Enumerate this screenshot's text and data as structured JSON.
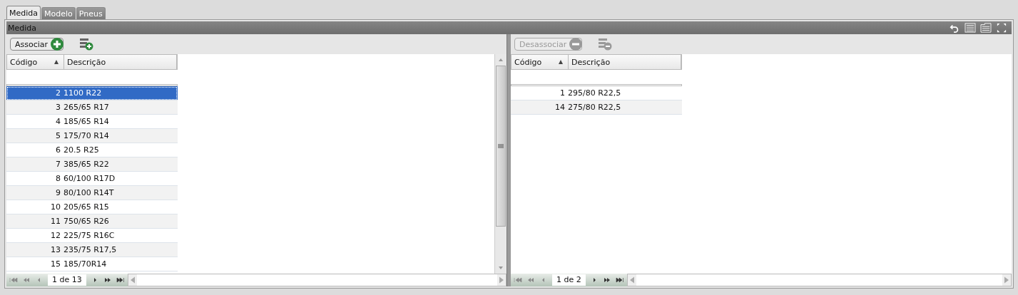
{
  "tabs": [
    {
      "label": "Medida",
      "selected": true
    },
    {
      "label": "Modelo",
      "selected": false
    },
    {
      "label": "Pneus",
      "selected": false
    }
  ],
  "panel": {
    "title": "Medida"
  },
  "left": {
    "button": {
      "label": "Associar",
      "disabled": false
    },
    "columns": [
      "Código",
      "Descrição"
    ],
    "rows": [
      {
        "code": "2",
        "description": "1100 R22",
        "selected": true
      },
      {
        "code": "3",
        "description": "265/65 R17",
        "selected": false
      },
      {
        "code": "4",
        "description": "185/65 R14",
        "selected": false
      },
      {
        "code": "5",
        "description": "175/70 R14",
        "selected": false
      },
      {
        "code": "6",
        "description": "20.5 R25",
        "selected": false
      },
      {
        "code": "7",
        "description": "385/65 R22",
        "selected": false
      },
      {
        "code": "8",
        "description": "60/100 R17D",
        "selected": false
      },
      {
        "code": "9",
        "description": "80/100 R14T",
        "selected": false
      },
      {
        "code": "10",
        "description": "205/65 R15",
        "selected": false
      },
      {
        "code": "11",
        "description": "750/65 R26",
        "selected": false
      },
      {
        "code": "12",
        "description": "225/75 R16C",
        "selected": false
      },
      {
        "code": "13",
        "description": "235/75 R17,5",
        "selected": false
      },
      {
        "code": "15",
        "description": "185/70R14",
        "selected": false
      }
    ],
    "pager": "1 de 13"
  },
  "right": {
    "button": {
      "label": "Desassociar",
      "disabled": true
    },
    "columns": [
      "Código",
      "Descrição"
    ],
    "rows": [
      {
        "code": "1",
        "description": "295/80 R22,5",
        "selected": false
      },
      {
        "code": "14",
        "description": "275/80 R22,5",
        "selected": false
      }
    ],
    "pager": "1 de 2"
  }
}
